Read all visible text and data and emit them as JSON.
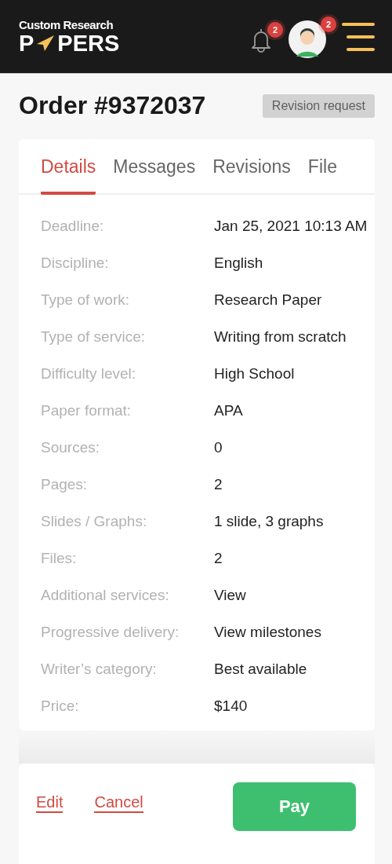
{
  "header": {
    "logo_top": "Custom Research",
    "logo_left": "P",
    "logo_right": "PERS",
    "notifications_badge": "2",
    "avatar_badge": "2"
  },
  "title": "Order #9372037",
  "status": "Revision request",
  "tabs": [
    {
      "label": "Details",
      "selected": true
    },
    {
      "label": "Messages",
      "selected": false
    },
    {
      "label": "Revisions",
      "selected": false
    },
    {
      "label": "File",
      "selected": false
    }
  ],
  "details": [
    {
      "label": "Deadline:",
      "value": "Jan 25, 2021 10:13 AM"
    },
    {
      "label": "Discipline:",
      "value": "English"
    },
    {
      "label": "Type of work:",
      "value": "Research Paper"
    },
    {
      "label": "Type of service:",
      "value": "Writing from scratch"
    },
    {
      "label": "Difficulty level:",
      "value": "High School"
    },
    {
      "label": "Paper format:",
      "value": "APA"
    },
    {
      "label": "Sources:",
      "value": "0"
    },
    {
      "label": "Pages:",
      "value": "2"
    },
    {
      "label": "Slides / Graphs:",
      "value": "1 slide, 3 graphs"
    },
    {
      "label": "Files:",
      "value": "2"
    },
    {
      "label": "Additional services:",
      "value": "View"
    },
    {
      "label": "Progressive delivery:",
      "value": "View milestones"
    },
    {
      "label": "Writer’s category:",
      "value": "Best available"
    },
    {
      "label": "Price:",
      "value": "$140"
    }
  ],
  "actions": {
    "edit": "Edit",
    "cancel": "Cancel",
    "pay": "Pay"
  }
}
